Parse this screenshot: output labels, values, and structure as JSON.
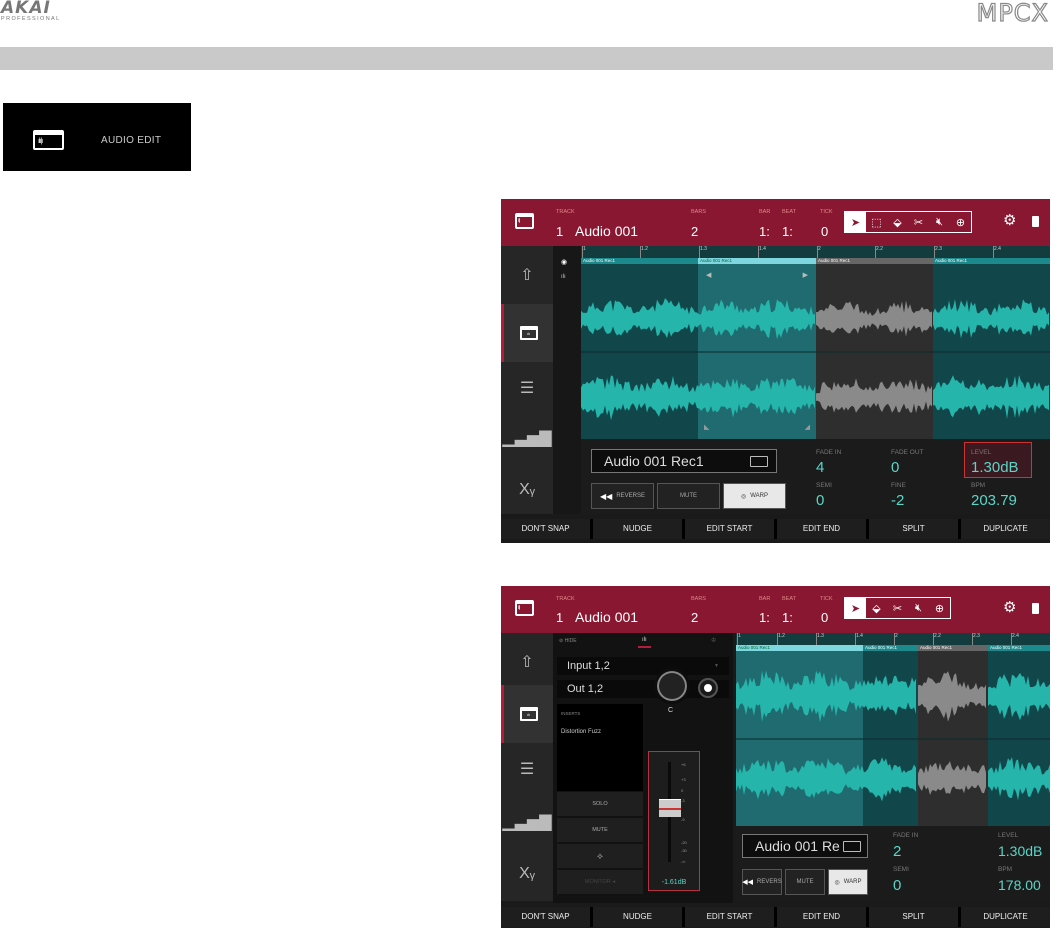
{
  "header": {
    "brand": "AKAI",
    "brand_sub": "PROFESSIONAL",
    "product": "MPCX"
  },
  "mode_badge": {
    "icon": "audio-edit-icon",
    "label": "AUDIO EDIT"
  },
  "colors": {
    "accent": "#8a1731",
    "wave": "#25b5ab",
    "selected_region": "#2a6e74",
    "muted_wave": "#8a8a8a",
    "value_text": "#5ad6c7"
  },
  "screen1": {
    "topbar": {
      "track_label": "TRACK",
      "track_num": "1",
      "track_name": "Audio 001",
      "bars_label": "BARS",
      "bars_value": "2",
      "bar_label": "BAR",
      "beat_label": "BEAT",
      "tick_label": "TICK",
      "bar_value": "1:",
      "beat_value": "1:",
      "tick_value": "0",
      "tools": [
        "select-tool-icon",
        "marquee-tool-icon",
        "eraser-tool-icon",
        "scissors-tool-icon",
        "mute-tool-icon",
        "zoom-tool-icon"
      ]
    },
    "ruler_ticks": [
      "1",
      "1.2",
      "1.3",
      "1.4",
      "2",
      "2.2",
      "2.3",
      "2.4"
    ],
    "regions": [
      {
        "label": "Audio 001 Rec1",
        "state": "normal"
      },
      {
        "label": "Audio 001 Rec1",
        "state": "selected"
      },
      {
        "label": "Audio 001 Rec1",
        "state": "muted"
      },
      {
        "label": "Audio 001 Rec1",
        "state": "normal"
      }
    ],
    "info": {
      "region_name": "Audio 001 Rec1",
      "reverse": "REVERSE",
      "mute": "MUTE",
      "warp": "WARP",
      "fade_in_label": "FADE IN",
      "fade_in": "4",
      "fade_out_label": "FADE OUT",
      "fade_out": "0",
      "level_label": "LEVEL",
      "level": "1.30dB",
      "semi_label": "SEMI",
      "semi": "0",
      "fine_label": "FINE",
      "fine": "-2",
      "bpm_label": "BPM",
      "bpm": "203.79"
    },
    "softkeys": [
      "DON'T SNAP",
      "NUDGE",
      "EDIT START",
      "EDIT END",
      "SPLIT",
      "DUPLICATE"
    ]
  },
  "screen2": {
    "topbar": {
      "track_label": "TRACK",
      "track_num": "1",
      "track_name": "Audio 001",
      "bars_label": "BARS",
      "bars_value": "2",
      "bar_label": "BAR",
      "beat_label": "BEAT",
      "tick_label": "TICK",
      "bar_value": "1:",
      "beat_value": "1:",
      "tick_value": "0"
    },
    "mixer": {
      "hide": "HIDE",
      "input": "Input 1,2",
      "output": "Out 1,2",
      "inserts_label": "INSERTS",
      "insert_1": "Distortion Fuzz",
      "solo": "SOLO",
      "mute": "MUTE",
      "monitor": "MONITOR",
      "pan": "C",
      "fader_value": "-1.61dB",
      "fader_level": 0.55,
      "fader_scale": [
        "+6",
        "+3",
        "0",
        "-3",
        "-9",
        "-20",
        "-30",
        "-∞"
      ]
    },
    "ruler_ticks": [
      "1",
      "1.2",
      "1.3",
      "1.4",
      "2",
      "2.2",
      "2.3",
      "2.4"
    ],
    "regions": [
      {
        "label": "Audio 001 Rec1",
        "state": "selected"
      },
      {
        "label": "Audio 001 Rec1",
        "state": "normal"
      },
      {
        "label": "Audio 001 Rec1",
        "state": "muted"
      },
      {
        "label": "Audio 001 Rec1",
        "state": "normal"
      }
    ],
    "info": {
      "region_name": "Audio 001 Re",
      "reverse": "REVERS",
      "mute": "MUTE",
      "warp": "WARP",
      "fade_in_label": "FADE IN",
      "fade_in": "2",
      "level_label": "LEVEL",
      "level": "1.30dB",
      "semi_label": "SEMI",
      "semi": "0",
      "bpm_label": "BPM",
      "bpm": "178.00"
    },
    "softkeys": [
      "DON'T SNAP",
      "NUDGE",
      "EDIT START",
      "EDIT END",
      "SPLIT",
      "DUPLICATE"
    ]
  }
}
